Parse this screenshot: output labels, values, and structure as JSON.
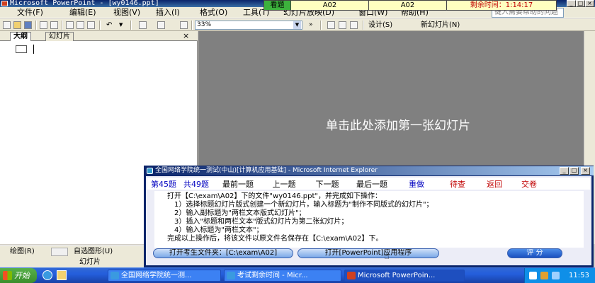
{
  "window": {
    "title": "Microsoft PowerPoint - [wy0146.ppt]"
  },
  "menu": {
    "items": [
      "文件(F)",
      "编辑(E)",
      "视图(V)",
      "插入(I)",
      "格式(O)",
      "工具(T)",
      "幻灯片放映(D)",
      "窗口(W)",
      "帮助(H)"
    ],
    "help_placeholder": "键入需要帮助的问题"
  },
  "exam_bar": {
    "label": "看题",
    "folder_1": "A02",
    "folder_2": "A02",
    "time_label": "剩余时间：1:14:17"
  },
  "toolbar": {
    "zoom": "33%",
    "design_label": "设计(S)",
    "new_slide_label": "新幻灯片(N)"
  },
  "left_pane": {
    "tab_outline": "大纲",
    "tab_slides": "幻灯片",
    "close": "×"
  },
  "slide": {
    "placeholder": "单击此处添加第一张幻灯片"
  },
  "dialog": {
    "title": "全国网络学院统一测试(中山)[计算机应用基础] - Microsoft Internet Explorer",
    "nav": {
      "question_prefix": "第",
      "current": "45",
      "question_suffix": "题",
      "total_prefix": "共",
      "total": "49",
      "total_suffix": "题",
      "first": "最前一题",
      "prev": "上一题",
      "next": "下一题",
      "last": "最后一题",
      "redo": "重做",
      "review": "待查",
      "back": "返回",
      "submit": "交卷"
    },
    "instructions": [
      "打开【C:\\exam\\A02】下的文件\"wy0146.ppt\"，并完成如下操作：",
      "1）选择标题幻灯片版式创建一个新幻灯片，输入标题为\"制作不同版式的幻灯片\"；",
      "2）输入副标题为\"两栏文本版式幻灯片\"；",
      "3）插入\"标题和两栏文本\"版式幻灯片为第二张幻灯片；",
      "4）输入标题为\"两栏文本\"；",
      "完成以上操作后，将该文件以原文件名保存在【C:\\exam\\A02】下。"
    ],
    "btn_open_folder": "打开考生文件夹：[C:\\exam\\A02]",
    "btn_open_app": "打开[PowerPoint]应用程序",
    "btn_score": "评  分"
  },
  "draw_toolbar": {
    "draw_label": "绘图(R)",
    "autoshape_label": "自选图形(U)"
  },
  "status": {
    "view_label": "幻灯片"
  },
  "taskbar": {
    "start": "开始",
    "tasks": [
      "全国网络学院统一测...",
      "考试剩余时间 - Micr...",
      "Microsoft PowerPoin..."
    ],
    "clock": "11:53"
  }
}
